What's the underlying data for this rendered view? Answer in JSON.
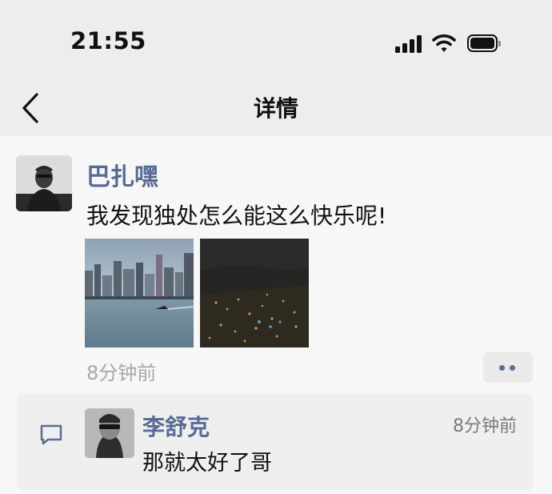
{
  "status_bar": {
    "time": "21:55"
  },
  "nav": {
    "title": "详情"
  },
  "post": {
    "author": "巴扎嘿",
    "text": "我发现独处怎么能这么快乐呢!",
    "time": "8分钟前"
  },
  "comments": [
    {
      "author": "李舒克",
      "time": "8分钟前",
      "text": "那就太好了哥"
    }
  ],
  "colors": {
    "link_blue": "#576b95",
    "header_bg": "#ededed",
    "page_bg": "#f7f7f7"
  }
}
